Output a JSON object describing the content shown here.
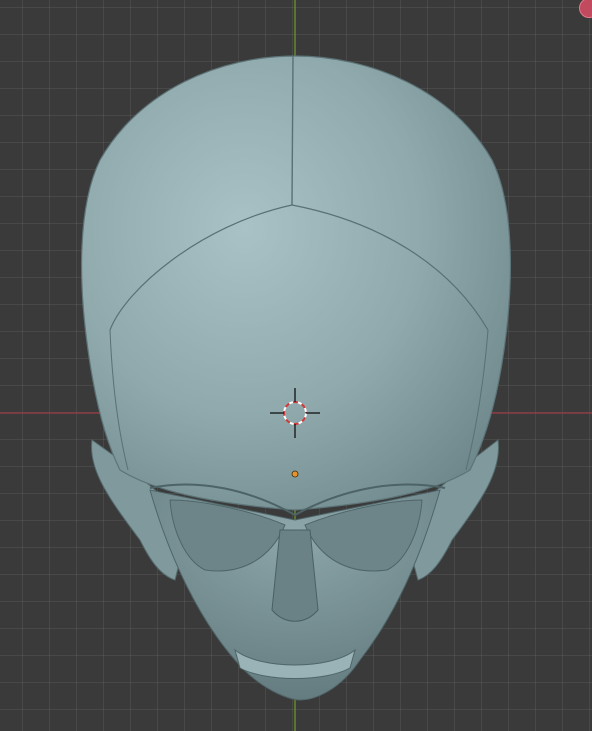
{
  "viewport": {
    "background_color": "#3a3a3a",
    "grid_color": "#4a4a4a",
    "x_axis_color": "#9b3a45",
    "y_axis_color": "#6f9a2d",
    "model_color": "#8fa9ad",
    "origin_color": "#e8942a"
  },
  "model": {
    "name_icon": "skull-mesh"
  },
  "cursor": {
    "icon": "3d-cursor-icon"
  },
  "gizmo": {
    "icon": "navigation-gizmo-x-icon"
  }
}
